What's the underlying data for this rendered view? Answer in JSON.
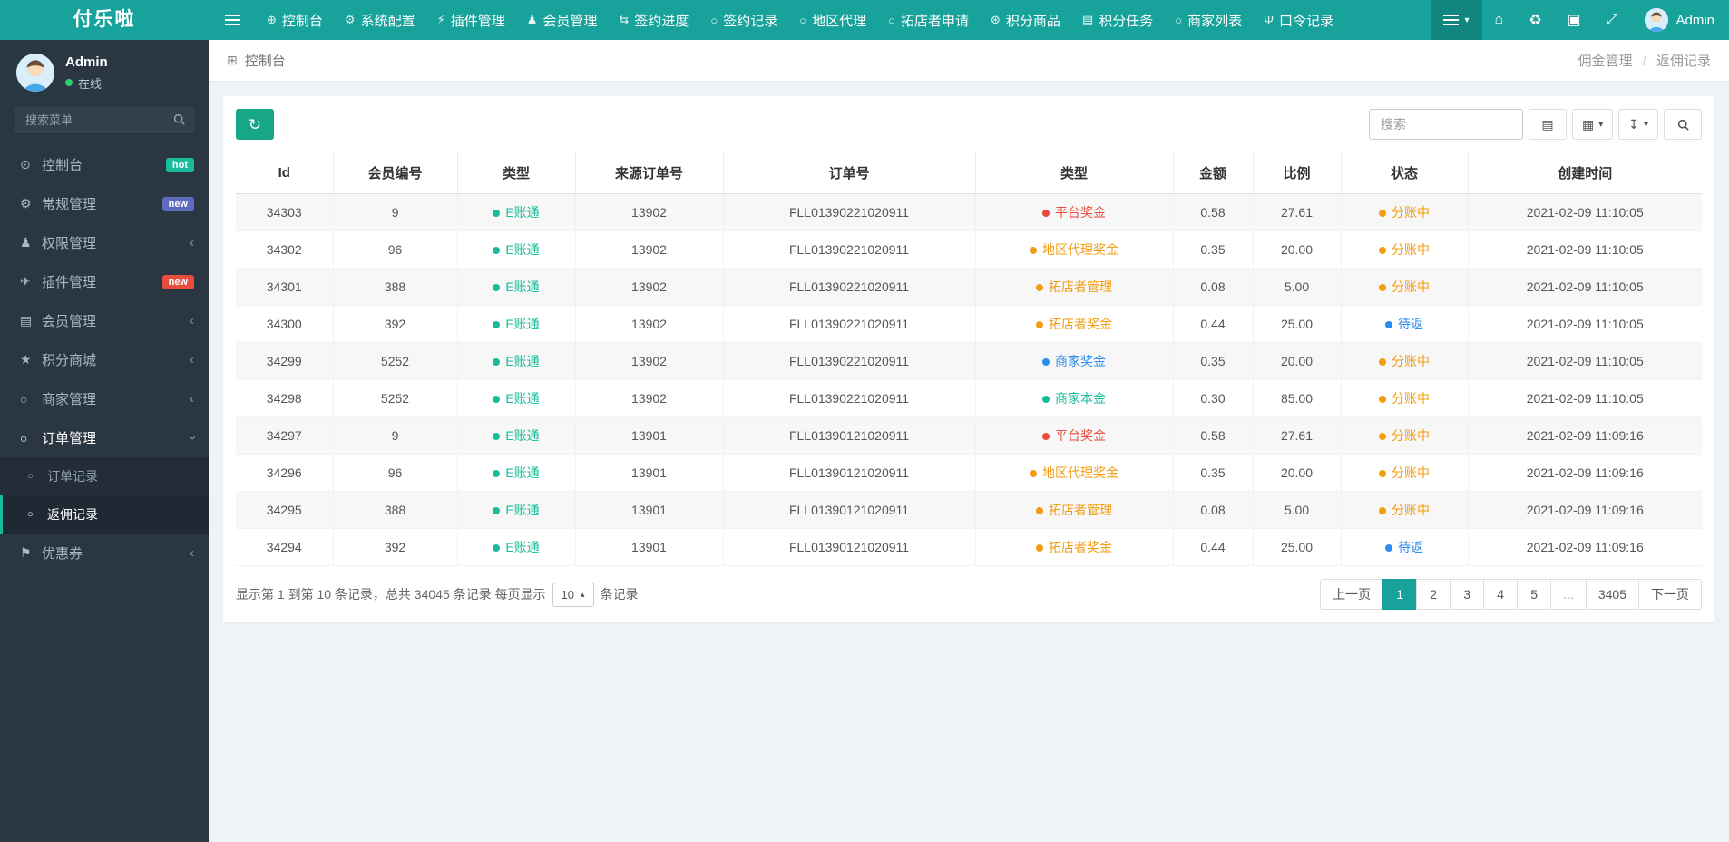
{
  "app": {
    "title": "付乐啦"
  },
  "colors": {
    "navbar": "#17a29b",
    "primary": "#18a689",
    "green": "#18bc9c",
    "red": "#e74c3c",
    "orange": "#f39c12",
    "blue": "#2d8cf0",
    "sidebar_bg": "#2b3643"
  },
  "topbar": {
    "logo": "付乐啦",
    "nav": [
      {
        "icon": "dashboard",
        "glyph": "⊕",
        "label": "控制台"
      },
      {
        "icon": "settings",
        "glyph": "⚙",
        "label": "系统配置"
      },
      {
        "icon": "plugin",
        "glyph": "⚡",
        "label": "插件管理"
      },
      {
        "icon": "member",
        "glyph": "♟",
        "label": "会员管理"
      },
      {
        "icon": "contract-progress",
        "glyph": "⇆",
        "label": "签约进度"
      },
      {
        "icon": "contract-record",
        "glyph": "○",
        "label": "签约记录"
      },
      {
        "icon": "region-agent",
        "glyph": "○",
        "label": "地区代理"
      },
      {
        "icon": "store-apply",
        "glyph": "○",
        "label": "拓店者申请"
      },
      {
        "icon": "points-goods",
        "glyph": "⊛",
        "label": "积分商品"
      },
      {
        "icon": "points-task",
        "glyph": "▤",
        "label": "积分任务"
      },
      {
        "icon": "merchant-list",
        "glyph": "○",
        "label": "商家列表"
      },
      {
        "icon": "token-record",
        "glyph": "Ψ",
        "label": "口令记录"
      }
    ],
    "right": {
      "caret": "▾",
      "home_glyph": "⌂",
      "trash_glyph": "♻",
      "terminal_glyph": "▣",
      "expand_glyph": "⤢",
      "admin_label": "Admin"
    }
  },
  "sidebar": {
    "user": {
      "name": "Admin",
      "status": "在线"
    },
    "search_placeholder": "搜索菜单",
    "chevron_glyph": "‹",
    "menu": [
      {
        "icon": "dashboard",
        "glyph": "⊙",
        "label": "控制台",
        "badge": {
          "text": "hot",
          "color": "#18bc9c"
        }
      },
      {
        "icon": "general",
        "glyph": "⚙",
        "label": "常规管理",
        "badge": {
          "text": "new",
          "color": "#5c6bc0"
        }
      },
      {
        "icon": "auth",
        "glyph": "♟",
        "label": "权限管理",
        "chevron": true
      },
      {
        "icon": "addon",
        "glyph": "✈",
        "label": "插件管理",
        "badge": {
          "text": "new",
          "color": "#e74c3c"
        }
      },
      {
        "icon": "member",
        "glyph": "▤",
        "label": "会员管理",
        "chevron": true
      },
      {
        "icon": "points-mall",
        "glyph": "★",
        "label": "积分商城",
        "chevron": true
      },
      {
        "icon": "merchant",
        "glyph": "○",
        "label": "商家管理",
        "chevron": true
      },
      {
        "icon": "order",
        "glyph": "○",
        "label": "订单管理",
        "expanded": true,
        "children": [
          {
            "glyph": "○",
            "label": "订单记录"
          },
          {
            "glyph": "○",
            "label": "返佣记录",
            "active": true
          }
        ]
      },
      {
        "icon": "coupon",
        "glyph": "⚑",
        "label": "优惠券",
        "chevron": true
      }
    ]
  },
  "breadcrumb": {
    "glyph": "⊞",
    "left": "控制台",
    "right_1": "佣金管理",
    "sep": "/",
    "right_2": "返佣记录"
  },
  "toolbar": {
    "refresh_glyph": "↻",
    "search_placeholder": "搜索",
    "view_glyph": "▤",
    "columns_glyph": "▦",
    "export_glyph": "↧",
    "caret": "▾"
  },
  "table": {
    "headers": [
      "Id",
      "会员编号",
      "类型",
      "来源订单号",
      "订单号",
      "类型",
      "金额",
      "比例",
      "状态",
      "创建时间"
    ],
    "rows": [
      {
        "id": "34303",
        "member_no": "9",
        "account_type": {
          "text": "E账通",
          "color": "#18bc9c"
        },
        "source_order_no": "13902",
        "order_no": "FLL01390221020911",
        "bonus_type": {
          "text": "平台奖金",
          "color": "#e74c3c"
        },
        "amount": "0.58",
        "ratio": "27.61",
        "status": {
          "text": "分账中",
          "color": "#f39c12"
        },
        "created_at": "2021-02-09 11:10:05"
      },
      {
        "id": "34302",
        "member_no": "96",
        "account_type": {
          "text": "E账通",
          "color": "#18bc9c"
        },
        "source_order_no": "13902",
        "order_no": "FLL01390221020911",
        "bonus_type": {
          "text": "地区代理奖金",
          "color": "#f39c12"
        },
        "amount": "0.35",
        "ratio": "20.00",
        "status": {
          "text": "分账中",
          "color": "#f39c12"
        },
        "created_at": "2021-02-09 11:10:05"
      },
      {
        "id": "34301",
        "member_no": "388",
        "account_type": {
          "text": "E账通",
          "color": "#18bc9c"
        },
        "source_order_no": "13902",
        "order_no": "FLL01390221020911",
        "bonus_type": {
          "text": "拓店者管理",
          "color": "#f39c12"
        },
        "amount": "0.08",
        "ratio": "5.00",
        "status": {
          "text": "分账中",
          "color": "#f39c12"
        },
        "created_at": "2021-02-09 11:10:05"
      },
      {
        "id": "34300",
        "member_no": "392",
        "account_type": {
          "text": "E账通",
          "color": "#18bc9c"
        },
        "source_order_no": "13902",
        "order_no": "FLL01390221020911",
        "bonus_type": {
          "text": "拓店者奖金",
          "color": "#f39c12"
        },
        "amount": "0.44",
        "ratio": "25.00",
        "status": {
          "text": "待返",
          "color": "#2d8cf0"
        },
        "created_at": "2021-02-09 11:10:05"
      },
      {
        "id": "34299",
        "member_no": "5252",
        "account_type": {
          "text": "E账通",
          "color": "#18bc9c"
        },
        "source_order_no": "13902",
        "order_no": "FLL01390221020911",
        "bonus_type": {
          "text": "商家奖金",
          "color": "#2d8cf0"
        },
        "amount": "0.35",
        "ratio": "20.00",
        "status": {
          "text": "分账中",
          "color": "#f39c12"
        },
        "created_at": "2021-02-09 11:10:05"
      },
      {
        "id": "34298",
        "member_no": "5252",
        "account_type": {
          "text": "E账通",
          "color": "#18bc9c"
        },
        "source_order_no": "13902",
        "order_no": "FLL01390221020911",
        "bonus_type": {
          "text": "商家本金",
          "color": "#18bc9c"
        },
        "amount": "0.30",
        "ratio": "85.00",
        "status": {
          "text": "分账中",
          "color": "#f39c12"
        },
        "created_at": "2021-02-09 11:10:05"
      },
      {
        "id": "34297",
        "member_no": "9",
        "account_type": {
          "text": "E账通",
          "color": "#18bc9c"
        },
        "source_order_no": "13901",
        "order_no": "FLL01390121020911",
        "bonus_type": {
          "text": "平台奖金",
          "color": "#e74c3c"
        },
        "amount": "0.58",
        "ratio": "27.61",
        "status": {
          "text": "分账中",
          "color": "#f39c12"
        },
        "created_at": "2021-02-09 11:09:16"
      },
      {
        "id": "34296",
        "member_no": "96",
        "account_type": {
          "text": "E账通",
          "color": "#18bc9c"
        },
        "source_order_no": "13901",
        "order_no": "FLL01390121020911",
        "bonus_type": {
          "text": "地区代理奖金",
          "color": "#f39c12"
        },
        "amount": "0.35",
        "ratio": "20.00",
        "status": {
          "text": "分账中",
          "color": "#f39c12"
        },
        "created_at": "2021-02-09 11:09:16"
      },
      {
        "id": "34295",
        "member_no": "388",
        "account_type": {
          "text": "E账通",
          "color": "#18bc9c"
        },
        "source_order_no": "13901",
        "order_no": "FLL01390121020911",
        "bonus_type": {
          "text": "拓店者管理",
          "color": "#f39c12"
        },
        "amount": "0.08",
        "ratio": "5.00",
        "status": {
          "text": "分账中",
          "color": "#f39c12"
        },
        "created_at": "2021-02-09 11:09:16"
      },
      {
        "id": "34294",
        "member_no": "392",
        "account_type": {
          "text": "E账通",
          "color": "#18bc9c"
        },
        "source_order_no": "13901",
        "order_no": "FLL01390121020911",
        "bonus_type": {
          "text": "拓店者奖金",
          "color": "#f39c12"
        },
        "amount": "0.44",
        "ratio": "25.00",
        "status": {
          "text": "待返",
          "color": "#2d8cf0"
        },
        "created_at": "2021-02-09 11:09:16"
      }
    ]
  },
  "footer": {
    "info_prefix": "显示第 1 到第 10 条记录，总共 34045 条记录 每页显示",
    "page_size": "10",
    "caret_up": "▴",
    "info_suffix": "条记录",
    "pages": [
      {
        "label": "上一页"
      },
      {
        "label": "1",
        "active": true
      },
      {
        "label": "2"
      },
      {
        "label": "3"
      },
      {
        "label": "4"
      },
      {
        "label": "5"
      },
      {
        "label": "...",
        "disabled": true
      },
      {
        "label": "3405"
      },
      {
        "label": "下一页"
      }
    ]
  }
}
